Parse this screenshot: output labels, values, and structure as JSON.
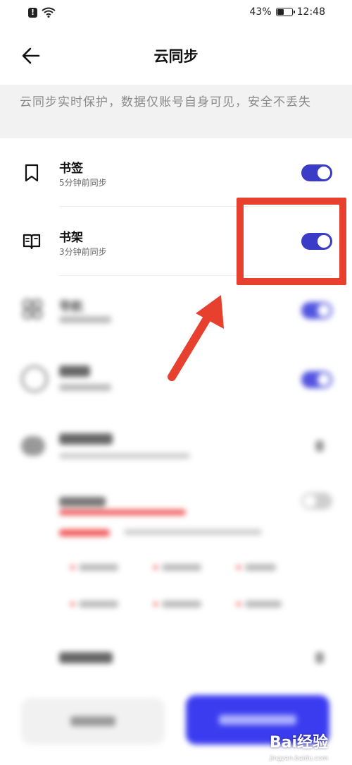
{
  "status_bar": {
    "battery_percent": "43%",
    "battery_level": 0.43,
    "time": "12:48"
  },
  "header": {
    "title": "云同步"
  },
  "banner": {
    "text": "云同步实时保护，数据仅账号自身可见，安全不丢失"
  },
  "sync_items": [
    {
      "label": "书签",
      "status": "5分钟前同步",
      "icon": "bookmark-icon",
      "enabled": true
    },
    {
      "label": "书架",
      "status": "3分钟前同步",
      "icon": "open-book-icon",
      "enabled": true
    },
    {
      "label": "导航",
      "icon": "grid-apps-icon",
      "enabled": true
    }
  ],
  "footer": {
    "watermark": "Bai经验",
    "watermark_url": "jingyan.baidu.com"
  },
  "colors": {
    "accent": "#3a3cc8",
    "primary_button": "#3b3cf0",
    "annotation_red": "#e8402e",
    "banner_bg": "#f2f2f2"
  }
}
